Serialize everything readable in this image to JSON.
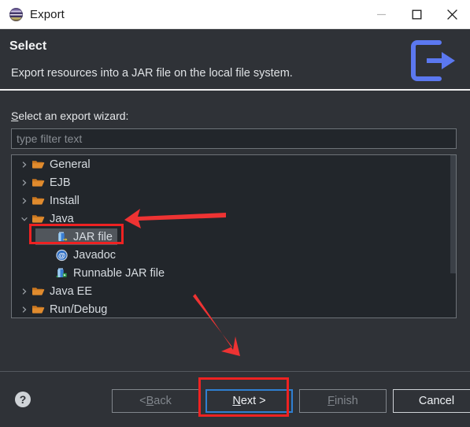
{
  "window": {
    "title": "Export",
    "app_icon": "eclipse-icon",
    "controls": {
      "minimize": "minimize-icon",
      "maximize": "maximize-icon",
      "close": "close-icon"
    }
  },
  "header": {
    "title": "Select",
    "description": "Export resources into a JAR file on the local file system.",
    "icon": "export-arrow-icon"
  },
  "body": {
    "wizard_label_mnemonic": "S",
    "wizard_label_rest": "elect an export wizard:",
    "filter": {
      "value": "",
      "placeholder": "type filter text"
    },
    "tree": [
      {
        "label": "General",
        "icon": "folder-icon",
        "level": 0,
        "expanded": false,
        "twisty": "chevron-right-icon",
        "selected": false
      },
      {
        "label": "EJB",
        "icon": "folder-icon",
        "level": 0,
        "expanded": false,
        "twisty": "chevron-right-icon",
        "selected": false
      },
      {
        "label": "Install",
        "icon": "folder-icon",
        "level": 0,
        "expanded": false,
        "twisty": "chevron-right-icon",
        "selected": false
      },
      {
        "label": "Java",
        "icon": "folder-icon",
        "level": 0,
        "expanded": true,
        "twisty": "chevron-down-icon",
        "selected": false
      },
      {
        "label": "JAR file",
        "icon": "jar-file-icon",
        "level": 1,
        "expanded": false,
        "twisty": "",
        "selected": true
      },
      {
        "label": "Javadoc",
        "icon": "javadoc-icon",
        "level": 1,
        "expanded": false,
        "twisty": "",
        "selected": false
      },
      {
        "label": "Runnable JAR file",
        "icon": "runnable-jar-icon",
        "level": 1,
        "expanded": false,
        "twisty": "",
        "selected": false
      },
      {
        "label": "Java EE",
        "icon": "folder-icon",
        "level": 0,
        "expanded": false,
        "twisty": "chevron-right-icon",
        "selected": false
      },
      {
        "label": "Run/Debug",
        "icon": "folder-icon",
        "level": 0,
        "expanded": false,
        "twisty": "chevron-right-icon",
        "selected": false
      }
    ]
  },
  "footer": {
    "help_icon": "help-question-icon",
    "buttons": [
      {
        "name": "back",
        "prefix": "< ",
        "mnemonic": "B",
        "suffix": "ack",
        "state": "disabled"
      },
      {
        "name": "next",
        "prefix": "",
        "mnemonic": "N",
        "suffix": "ext >",
        "state": "focused"
      },
      {
        "name": "finish",
        "prefix": "",
        "mnemonic": "F",
        "suffix": "inish",
        "state": "disabled"
      },
      {
        "name": "cancel",
        "prefix": "",
        "mnemonic": "",
        "suffix": "Cancel",
        "state": "enabled"
      }
    ]
  },
  "annotations": {
    "color": "#ee2222",
    "shapes": [
      "rect-around-jar-file",
      "rect-around-next-button",
      "arrow-pointing-to-java",
      "arrow-pointing-to-next-button"
    ]
  },
  "colors": {
    "dialog_background": "#2f3237",
    "field_background": "#22262b",
    "titlebar_background": "#ffffff",
    "accent_focus": "#2f7fd1",
    "header_icon": "#5b78f0",
    "annotation": "#ee2222",
    "folder_icon": "#e08b2e"
  }
}
